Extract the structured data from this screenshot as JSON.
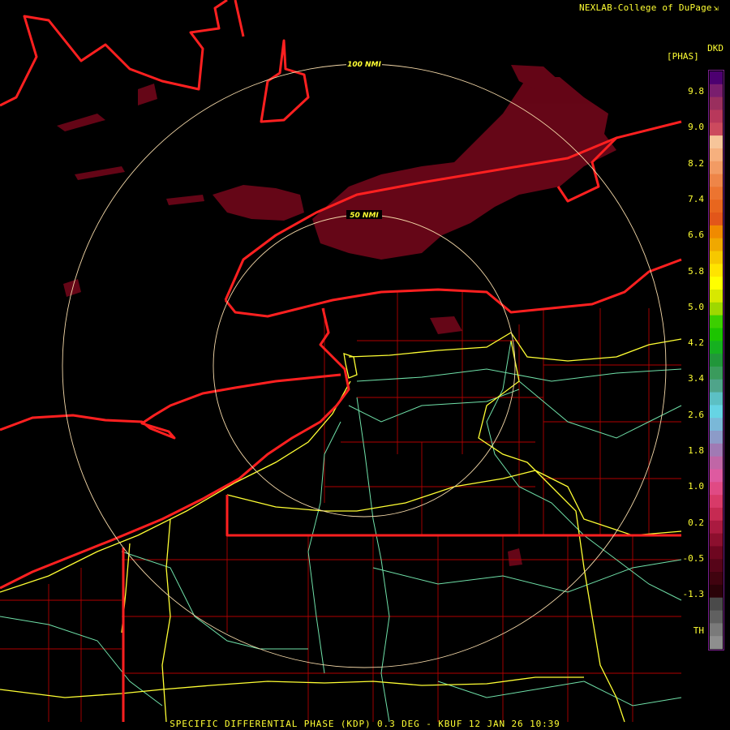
{
  "header": {
    "credit": "NEXLAB-College of DuPage",
    "credit_icon": "external-link-icon"
  },
  "legend": {
    "product": "DKD",
    "units": "[PHAS]",
    "ticks": [
      "9.8",
      "9.0",
      "8.2",
      "7.4",
      "6.6",
      "5.8",
      "5.0",
      "4.2",
      "3.4",
      "2.6",
      "1.8",
      "1.0",
      "0.2",
      "-0.5",
      "-1.3",
      "TH"
    ],
    "colors": [
      "#4c0070",
      "#7a1e6e",
      "#9a2f5e",
      "#b8385b",
      "#cc4a5e",
      "#f6c59a",
      "#f6b07e",
      "#f29b64",
      "#ee8548",
      "#ec7430",
      "#e8661e",
      "#e2561a",
      "#f08a00",
      "#f0a800",
      "#f6c800",
      "#ffe400",
      "#ffff00",
      "#d8e800",
      "#9ed800",
      "#3ccf00",
      "#1cc400",
      "#16b020",
      "#21963a",
      "#3a9b5c",
      "#4fa48a",
      "#5cc0c4",
      "#66d4e4",
      "#7ab8d8",
      "#8c9bc8",
      "#a07ab4",
      "#c066a6",
      "#de5aa0",
      "#e04a84",
      "#d83a68",
      "#c62a52",
      "#aa1a40",
      "#8c0f2e",
      "#6e0620",
      "#560418",
      "#40030f",
      "#2a0208",
      "#4a4a4a",
      "#606060",
      "#7a7a7a",
      "#8e8e8e"
    ]
  },
  "radar": {
    "rings": [
      {
        "label": "50 NMI",
        "range_nmi": 50
      },
      {
        "label": "100 NMI",
        "range_nmi": 100
      }
    ],
    "colors": {
      "state_border": "#ff2020",
      "county_border": "#b00000",
      "interstate": "#ffff33",
      "highway": "#6fe0a8",
      "ring": "#f4d8a8",
      "echo": "#6a0618"
    }
  },
  "footer": {
    "caption": "SPECIFIC DIFFERENTIAL PHASE (KDP) 0.3 DEG - KBUF 12 JAN 26 10:39"
  }
}
